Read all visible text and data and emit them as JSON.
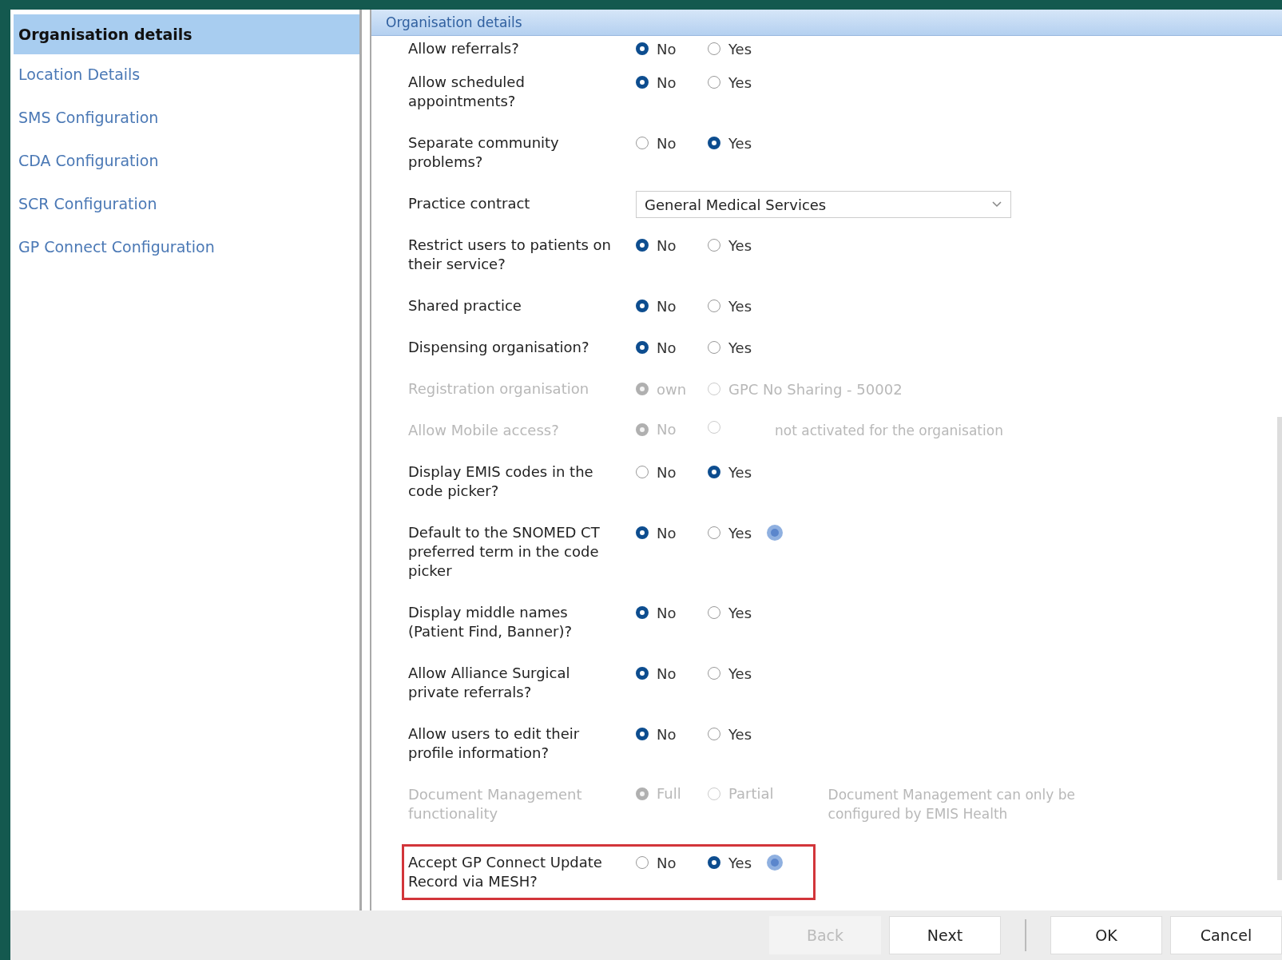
{
  "sidebar": {
    "items": [
      {
        "label": "Organisation details",
        "selected": true
      },
      {
        "label": "Location Details",
        "selected": false
      },
      {
        "label": "SMS Configuration",
        "selected": false
      },
      {
        "label": "CDA Configuration",
        "selected": false
      },
      {
        "label": "SCR Configuration",
        "selected": false
      },
      {
        "label": "GP Connect Configuration",
        "selected": false
      }
    ]
  },
  "panel": {
    "title": "Organisation details",
    "rows": [
      {
        "label": "Allow referrals?",
        "disabled": false,
        "highlighted": false,
        "options": [
          {
            "label": "No",
            "selected": true
          },
          {
            "label": "Yes",
            "selected": false
          }
        ]
      },
      {
        "label": "Allow scheduled appointments?",
        "disabled": false,
        "highlighted": false,
        "options": [
          {
            "label": "No",
            "selected": true
          },
          {
            "label": "Yes",
            "selected": false
          }
        ]
      },
      {
        "label": "Separate community problems?",
        "disabled": false,
        "highlighted": false,
        "options": [
          {
            "label": "No",
            "selected": false
          },
          {
            "label": "Yes",
            "selected": true
          }
        ]
      },
      {
        "label": "Practice contract",
        "disabled": false,
        "highlighted": false,
        "select": {
          "value": "General Medical Services"
        }
      },
      {
        "label": "Restrict users to patients on their service?",
        "disabled": false,
        "highlighted": false,
        "options": [
          {
            "label": "No",
            "selected": true
          },
          {
            "label": "Yes",
            "selected": false
          }
        ]
      },
      {
        "label": "Shared practice",
        "disabled": false,
        "highlighted": false,
        "options": [
          {
            "label": "No",
            "selected": true
          },
          {
            "label": "Yes",
            "selected": false
          }
        ]
      },
      {
        "label": "Dispensing organisation?",
        "disabled": false,
        "highlighted": false,
        "options": [
          {
            "label": "No",
            "selected": true
          },
          {
            "label": "Yes",
            "selected": false
          }
        ]
      },
      {
        "label": "Registration organisation",
        "disabled": true,
        "highlighted": false,
        "options": [
          {
            "label": "own",
            "selected": true
          },
          {
            "label": "GPC No Sharing - 50002",
            "selected": false
          }
        ]
      },
      {
        "label": "Allow Mobile access?",
        "disabled": true,
        "highlighted": false,
        "options": [
          {
            "label": "No",
            "selected": true
          },
          {
            "selected": false
          }
        ],
        "note": "not activated for the organisation"
      },
      {
        "label": "Display EMIS codes in the code picker?",
        "disabled": false,
        "highlighted": false,
        "options": [
          {
            "label": "No",
            "selected": false
          },
          {
            "label": "Yes",
            "selected": true
          }
        ]
      },
      {
        "label": "Default to the SNOMED CT preferred term in the code picker",
        "disabled": false,
        "highlighted": false,
        "info": true,
        "options": [
          {
            "label": "No",
            "selected": true
          },
          {
            "label": "Yes",
            "selected": false
          }
        ]
      },
      {
        "label": "Display middle names (Patient Find, Banner)?",
        "disabled": false,
        "highlighted": false,
        "options": [
          {
            "label": "No",
            "selected": true
          },
          {
            "label": "Yes",
            "selected": false
          }
        ]
      },
      {
        "label": "Allow Alliance Surgical private referrals?",
        "disabled": false,
        "highlighted": false,
        "options": [
          {
            "label": "No",
            "selected": true
          },
          {
            "label": "Yes",
            "selected": false
          }
        ]
      },
      {
        "label": "Allow users to edit their profile information?",
        "disabled": false,
        "highlighted": false,
        "options": [
          {
            "label": "No",
            "selected": true
          },
          {
            "label": "Yes",
            "selected": false
          }
        ]
      },
      {
        "label": "Document Management functionality",
        "disabled": true,
        "highlighted": false,
        "options": [
          {
            "label": "Full",
            "selected": true
          },
          {
            "label": "Partial",
            "selected": false
          }
        ],
        "note": "Document Management can only be configured by EMIS Health"
      },
      {
        "label": "Accept GP Connect Update Record via MESH?",
        "disabled": false,
        "highlighted": true,
        "info": true,
        "options": [
          {
            "label": "No",
            "selected": false
          },
          {
            "label": "Yes",
            "selected": true
          }
        ]
      }
    ]
  },
  "buttons": [
    {
      "label": "Back",
      "disabled": true
    },
    {
      "label": "Next",
      "disabled": false
    },
    {
      "label": "OK",
      "disabled": false
    },
    {
      "label": "Cancel",
      "disabled": false
    }
  ]
}
